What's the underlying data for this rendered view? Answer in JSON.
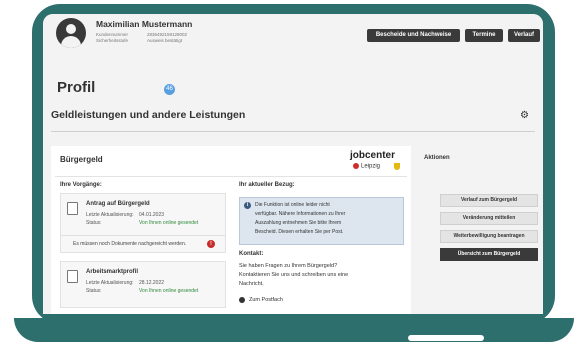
{
  "user": {
    "name": "Maximilian Mustermann",
    "customer_label": "Kundennummer",
    "customer_value": "2836492159128002",
    "security_label": "Sicherheitsstufe",
    "security_value": "Ausweis bestätigt"
  },
  "nav": {
    "buttons": [
      "Bescheide und Nachweise",
      "Termine",
      "Verlauf"
    ]
  },
  "page": {
    "title": "Profil",
    "badge": "46",
    "section_title": "Geldleistungen und andere Leistungen"
  },
  "card": {
    "title": "Bürgergeld",
    "logo_main": "jobcenter",
    "logo_city": "Leipzig",
    "procedures_heading": "Ihre Vorgänge:",
    "procedures": [
      {
        "title": "Antrag auf Bürgergeld",
        "updated_label": "Letzte Aktualisierung:",
        "updated_value": "04.01.2023",
        "status_label": "Status:",
        "status_value": "Von Ihnen online gesendet",
        "note": "Es müssen noch Dokumente nachgereicht werden.",
        "warning": "!"
      },
      {
        "title": "Arbeitsmarktprofil",
        "updated_label": "Letzte Aktualisierung:",
        "updated_value": "28.12.2022",
        "status_label": "Status:",
        "status_value": "Von Ihnen online gesendet"
      }
    ],
    "current_heading": "Ihr aktueller Bezug:",
    "info_icon": "i",
    "info_lines": [
      "Die Funktion ist online leider nicht",
      "verfügbar. Nähere Informationen zu Ihrer",
      "Auszahlung entnehmen Sie bitte Ihrem",
      "Bescheid. Diesen erhalten Sie per Post."
    ],
    "contact_heading": "Kontakt:",
    "contact_lines": [
      "Sie haben Fragen zu Ihrem Bürgergeld?",
      "Kontaktieren Sie uns und schreiben uns eine",
      "Nachricht."
    ],
    "contact_link": "Zum Postfach"
  },
  "actions": {
    "title": "Aktionen",
    "buttons": [
      "Verlauf zum Bürgergeld",
      "Veränderung mitteilen",
      "Weiterbewilligung beantragen",
      "Übersicht zum Bürgergeld"
    ]
  },
  "colors": {
    "device_frame": "#2d6f6d",
    "dark_button": "#3a3a3a",
    "status_green": "#2f8a3a",
    "warning_red": "#c72d2d",
    "info_blue": "#dde6ef"
  }
}
